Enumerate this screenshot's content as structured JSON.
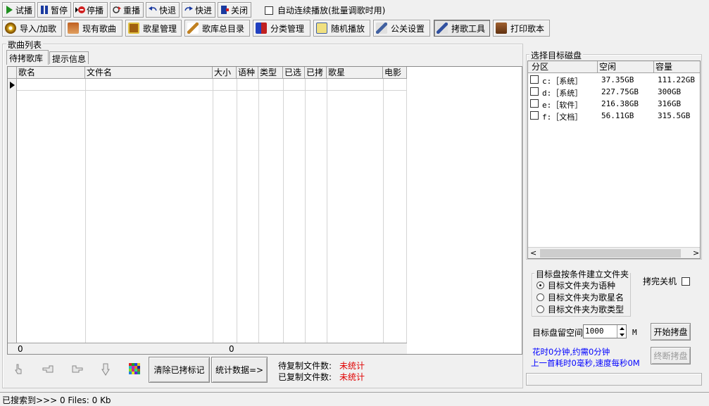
{
  "toolbar": {
    "play": "试播",
    "pause": "暂停",
    "stop": "停播",
    "replay": "重播",
    "rewind": "快退",
    "forward": "快进",
    "close": "关闭",
    "auto_play": "自动连续播放(批量调歌时用)"
  },
  "tabs": [
    {
      "label": "导入/加歌"
    },
    {
      "label": "现有歌曲"
    },
    {
      "label": "歌星管理"
    },
    {
      "label": "歌库总目录"
    },
    {
      "label": "分类管理"
    },
    {
      "label": "随机播放"
    },
    {
      "label": "公关设置"
    },
    {
      "label": "拷歌工具"
    },
    {
      "label": "打印歌本"
    }
  ],
  "song_list": {
    "group_title": "歌曲列表",
    "subtabs": [
      "待拷歌库",
      "提示信息"
    ],
    "columns": [
      "歌名",
      "文件名",
      "大小",
      "语种",
      "类型",
      "已选",
      "已拷",
      "歌星",
      "电影"
    ],
    "footer_count": "0",
    "footer_size": "0"
  },
  "actions": {
    "clear_marks": "清除已拷标记",
    "stats": "统计数据=>",
    "pending_label": "待复制文件数:",
    "pending_value": "未统计",
    "copied_label": "已复制文件数:",
    "copied_value": "未统计"
  },
  "disk": {
    "group_title": "选择目标磁盘",
    "columns": [
      "分区",
      "空闲",
      "容量"
    ],
    "rows": [
      {
        "part": "c:［系统］",
        "free": "37.35GB",
        "cap": "111.22GB"
      },
      {
        "part": "d:［系统］",
        "free": "227.75GB",
        "cap": "300GB"
      },
      {
        "part": "e:［软件］",
        "free": "216.38GB",
        "cap": "316GB"
      },
      {
        "part": "f:［文档］",
        "free": "56.11GB",
        "cap": "315.5GB"
      }
    ]
  },
  "folder_options": {
    "title": "目标盘按条件建立文件夹",
    "options": [
      "目标文件夹为语种",
      "目标文件夹为歌星名",
      "目标文件夹为歌类型"
    ],
    "selected": 0
  },
  "shutdown_label": "拷完关机",
  "reserve": {
    "label": "目标盘留空间",
    "value": "1000",
    "unit": "M"
  },
  "start_button": "开始拷盘",
  "stop_button": "终断拷盘",
  "info": {
    "line1": "花时0分钟,约需0分钟",
    "line2": "上一首耗时0毫秒,速度每秒0M",
    "color": "#0000ff"
  },
  "status": "已搜索到>>> 0 Files: 0 Kb"
}
